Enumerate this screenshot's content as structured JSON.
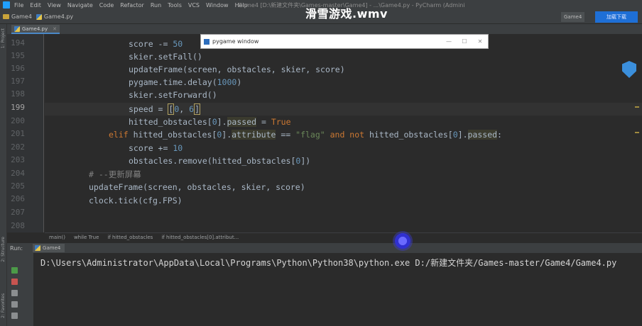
{
  "menubar": {
    "items": [
      "File",
      "Edit",
      "View",
      "Navigate",
      "Code",
      "Refactor",
      "Run",
      "Tools",
      "VCS",
      "Window",
      "Help"
    ],
    "window_title": "Game4 [D:\\新建文件夹\\Games-master\\Game4] - ...\\Game4.py - PyCharm (Administrator)"
  },
  "navbar": {
    "project": "Game4",
    "file": "Game4.py",
    "run_config": "Game4",
    "blue_button": "加载下载"
  },
  "video_title": "滑雪游戏.wmv",
  "left_strip": {
    "project_tab": "1: Project",
    "structure_tab": "2: Structure",
    "favorites_tab": "2: Favorites"
  },
  "tabs": [
    {
      "label": "Game4.py"
    }
  ],
  "editor": {
    "line_numbers": [
      "194",
      "195",
      "196",
      "197",
      "198",
      "199",
      "200",
      "201",
      "202",
      "203",
      "204",
      "205",
      "206",
      "207",
      "208"
    ],
    "lines": {
      "l194_a": "score -= ",
      "l194_b": "50",
      "l195": "skier.setFall()",
      "l196": "updateFrame(screen, obstacles, skier, score)",
      "l197_a": "pygame.time.delay(",
      "l197_b": "1000",
      "l197_c": ")",
      "l198": "skier.setForward()",
      "l199_a": "speed = ",
      "l199_b": "[",
      "l199_c": "0",
      "l199_d": ", ",
      "l199_e": "6",
      "l199_f": "]",
      "l200_a": "hitted_obstacles[",
      "l200_b": "0",
      "l200_c": "].",
      "l200_d": "passed",
      "l200_e": " = ",
      "l200_f": "True",
      "l201_a": "elif ",
      "l201_b": "hitted_obstacles[",
      "l201_c": "0",
      "l201_d": "].",
      "l201_e": "attribute",
      "l201_f": " == ",
      "l201_g": "\"flag\"",
      "l201_h": " and not ",
      "l201_i": "hitted_obstacles[",
      "l201_j": "0",
      "l201_k": "].",
      "l201_l": "passed",
      "l201_m": ":",
      "l202_a": "score += ",
      "l202_b": "10",
      "l203_a": "obstacles.remove(hitted_obstacles[",
      "l203_b": "0",
      "l203_c": "])",
      "l204": "# --更新屏幕",
      "l205": "updateFrame(screen, obstacles, skier, score)",
      "l206": "clock.tick(cfg.FPS)"
    }
  },
  "breadcrumb": [
    "main()",
    "while True",
    "if hitted_obstacles",
    "if hitted_obstacles[0].attribut..."
  ],
  "run_window": {
    "header_label": "Run:",
    "tab_label": "Game4",
    "output": "D:\\Users\\Administrator\\AppData\\Local\\Programs\\Python\\Python38\\python.exe D:/新建文件夹/Games-master/Game4/Game4.py"
  },
  "pygame_window": {
    "title": "pygame window",
    "minimize": "—",
    "maximize": "☐",
    "close": "✕"
  },
  "colors": {
    "editor_bg": "#2b2b2b",
    "keyword": "#cc7832",
    "number": "#6897bb",
    "string": "#6a8759",
    "comment": "#808080"
  }
}
